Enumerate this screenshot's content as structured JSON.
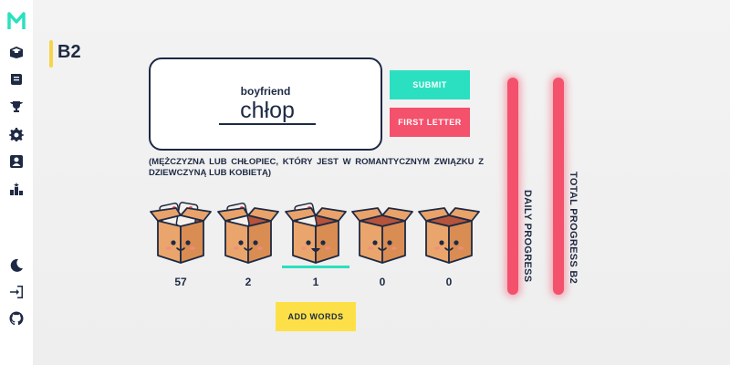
{
  "app": {
    "logo_letter": "M"
  },
  "sidebar": {
    "top_items": [
      {
        "name": "box-icon"
      },
      {
        "name": "scroll-icon"
      },
      {
        "name": "trophy-icon"
      },
      {
        "name": "gear-icon"
      },
      {
        "name": "profile-icon"
      },
      {
        "name": "leaderboard-icon"
      }
    ],
    "bottom_items": [
      {
        "name": "moon-icon"
      },
      {
        "name": "logout-icon"
      },
      {
        "name": "github-icon"
      }
    ]
  },
  "level": {
    "label": "B2"
  },
  "card": {
    "hint": "boyfriend",
    "input_value": "chłop"
  },
  "buttons": {
    "submit": "SUBMIT",
    "first_letter": "FIRST LETTER",
    "add_words": "ADD WORDS"
  },
  "definition": "(mężczyzna lub chłopiec, który jest w romantycznym związku z dziewczyną lub kobietą)",
  "boxes": [
    {
      "count": "57",
      "cards": 2,
      "selected": false
    },
    {
      "count": "2",
      "cards": 1,
      "selected": false
    },
    {
      "count": "1",
      "cards": 1,
      "selected": true
    },
    {
      "count": "0",
      "cards": 0,
      "selected": false
    },
    {
      "count": "0",
      "cards": 0,
      "selected": false
    }
  ],
  "progress": {
    "daily_label": "DAILY PROGRESS",
    "total_label": "TOTAL PROGRESS B2"
  },
  "colors": {
    "accent_teal": "#2be0c0",
    "accent_red": "#f4516c",
    "accent_yellow": "#fde047",
    "ink": "#1e2a44"
  }
}
